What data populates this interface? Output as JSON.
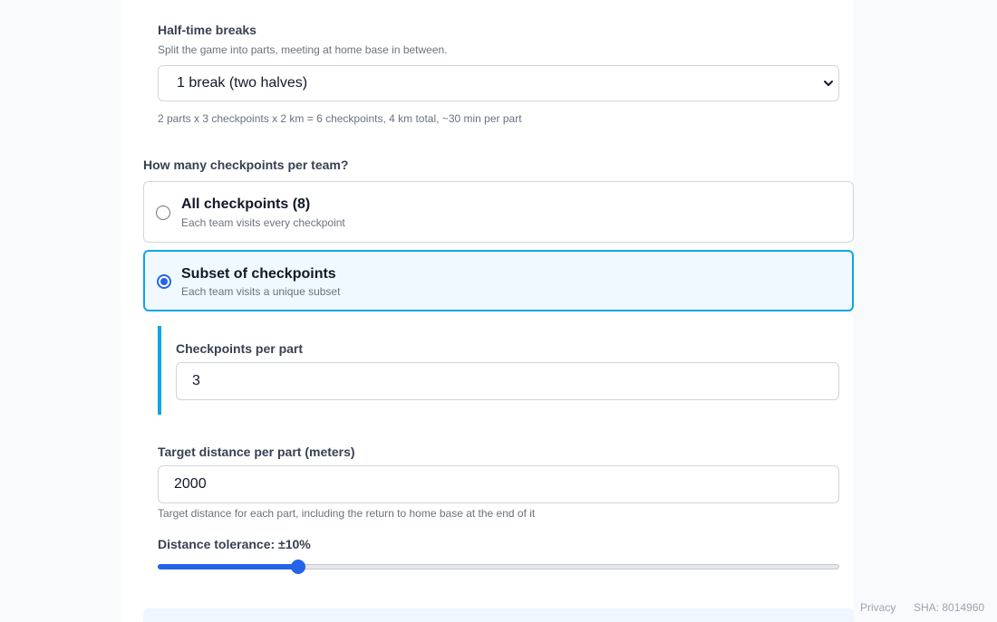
{
  "half_time": {
    "label": "Half-time breaks",
    "description": "Split the game into parts, meeting at home base in between.",
    "selected": "1 break (two halves)",
    "summary": "2 parts x 3 checkpoints x 2 km = 6 checkpoints, 4 km total, ~30 min per part"
  },
  "checkpoints": {
    "question": "How many checkpoints per team?",
    "options": [
      {
        "title": "All checkpoints (8)",
        "desc": "Each team visits every checkpoint",
        "checked": false
      },
      {
        "title": "Subset of checkpoints",
        "desc": "Each team visits a unique subset",
        "checked": true
      }
    ],
    "per_part_label": "Checkpoints per part",
    "per_part_value": "3"
  },
  "distance": {
    "label": "Target distance per part (meters)",
    "value": "2000",
    "hint": "Target distance for each part, including the return to home base at the end of it"
  },
  "tolerance": {
    "label": "Distance tolerance: ±10%",
    "fraction": 0.2
  },
  "footer": {
    "privacy": "Privacy",
    "sha": "SHA: 8014960"
  },
  "colors": {
    "accent": "#0ea5e9",
    "primary": "#2563eb"
  }
}
